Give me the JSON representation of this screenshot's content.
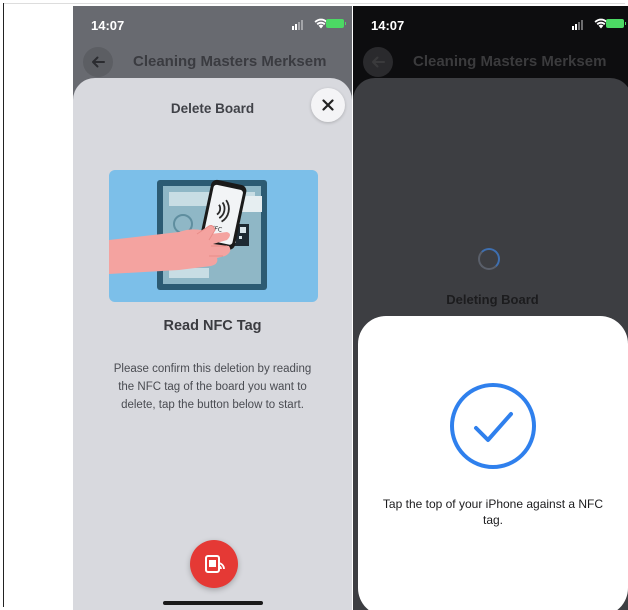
{
  "left_screen": {
    "status": {
      "time": "14:07"
    },
    "header": {
      "title": "Cleaning Masters Merksem"
    },
    "sheet": {
      "title": "Delete Board",
      "heading": "Read NFC Tag",
      "instructions": "Please confirm this deletion by reading the NFC tag of the board you want to delete, tap the button below to start.",
      "illustration_phone_label": "NFC"
    }
  },
  "right_screen": {
    "status": {
      "time": "14:07"
    },
    "header": {
      "title": "Cleaning Masters Merksem"
    },
    "loading_text": "Deleting Board",
    "nfc_prompt": "Tap the top of your iPhone against a NFC tag."
  },
  "colors": {
    "accent_red": "#e53935",
    "check_blue": "#2f80ed",
    "illustration_bg": "#7cbfe9",
    "battery_green": "#4cd964"
  }
}
